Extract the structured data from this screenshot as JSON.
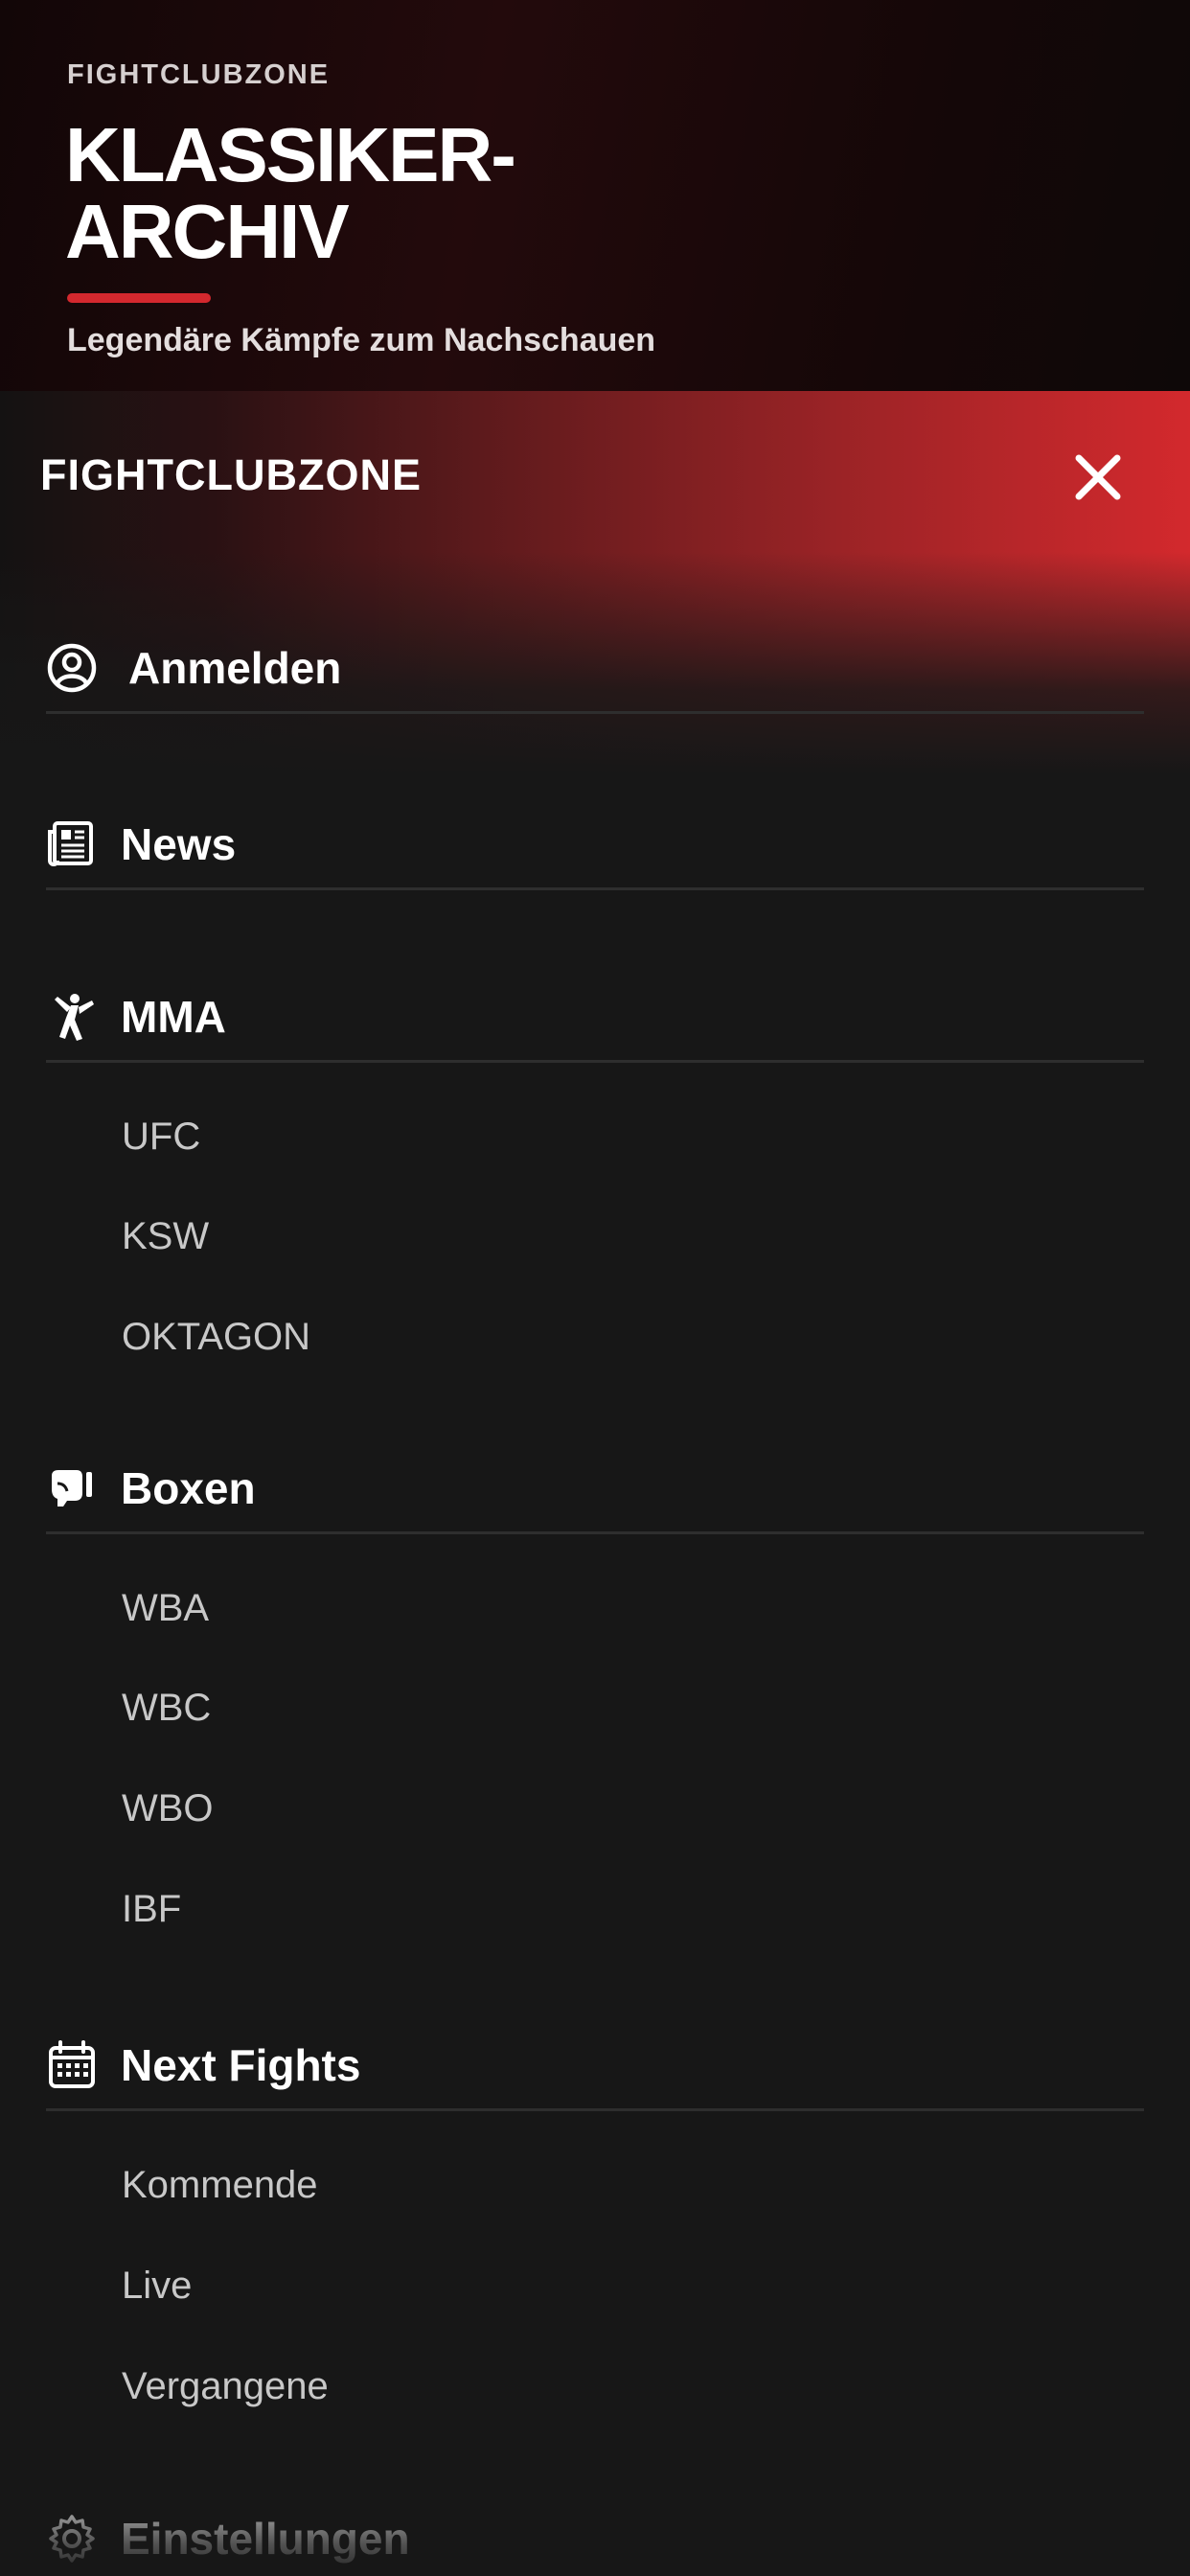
{
  "background_page": {
    "brand": "FIGHTCLUBZONE",
    "title_line1": "KLASSIKER-",
    "title_line2": "ARCHIV",
    "subtitle": "Legendäre Kämpfe zum Nachschauen",
    "accent_color": "#d3282e"
  },
  "drawer": {
    "brand": "FIGHTCLUBZONE",
    "close_icon": "close-icon",
    "sections": [
      {
        "label": "Anmelden",
        "icon": "user-circle-icon",
        "items": []
      },
      {
        "label": "News",
        "icon": "newspaper-icon",
        "items": []
      },
      {
        "label": "MMA",
        "icon": "martial-arts-kick-icon",
        "items": [
          "UFC",
          "KSW",
          "OKTAGON"
        ]
      },
      {
        "label": "Boxen",
        "icon": "boxing-glove-icon",
        "items": [
          "WBA",
          "WBC",
          "WBO",
          "IBF"
        ]
      },
      {
        "label": "Next Fights",
        "icon": "calendar-icon",
        "items": [
          "Kommende",
          "Live",
          "Vergangene"
        ]
      },
      {
        "label": "Einstellungen",
        "icon": "gear-icon",
        "items": []
      }
    ]
  },
  "colors": {
    "drawer_background": "#171717",
    "accent_red": "#d3292d",
    "divider": "#2e2e2e",
    "sub_item_text": "#c8c8c8"
  }
}
